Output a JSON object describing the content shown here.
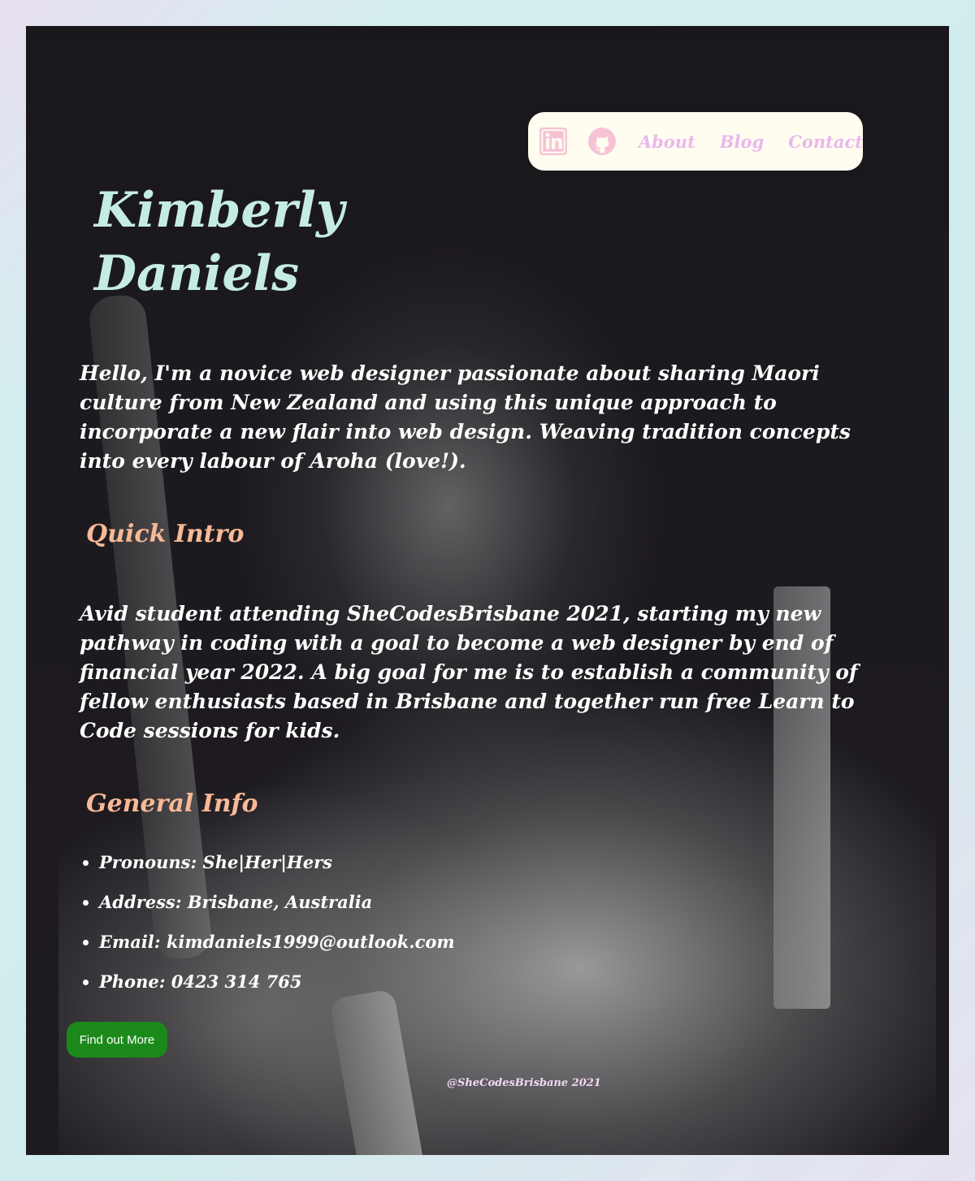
{
  "nav": {
    "icons": [
      "linkedin-icon",
      "github-icon"
    ],
    "links": [
      "About",
      "Blog",
      "Contact"
    ]
  },
  "profile": {
    "first_name": "Kimberly",
    "last_name": "Daniels",
    "intro": "Hello, I'm a novice web designer passionate about sharing Maori culture from New Zealand and using this unique approach to incorporate a new flair into web design. Weaving tradition concepts into every labour of Aroha (love!)."
  },
  "quick_intro": {
    "heading": "Quick Intro",
    "body": "Avid student attending SheCodesBrisbane 2021, starting my new pathway in coding with a goal to become a web designer by end of financial year 2022. A big goal for me is to establish a community of fellow enthusiasts based in Brisbane and together run free Learn to Code sessions for kids."
  },
  "general_info": {
    "heading": "General Info",
    "items": [
      "Pronouns: She|Her|Hers",
      "Address: Brisbane, Australia",
      "Email: kimdaniels1999@outlook.com",
      "Phone: 0423 314 765"
    ]
  },
  "button": {
    "label": "Find out More"
  },
  "footer": {
    "text": "@SheCodesBrisbane 2021"
  },
  "colors": {
    "name": "#c5ece4",
    "heading": "#f8b996",
    "nav_link": "#e9b8ee",
    "icon": "#f6c3d6",
    "button": "#1b8a1b",
    "card_bg": "#1e1b20",
    "nav_bg": "#fffdf0"
  }
}
